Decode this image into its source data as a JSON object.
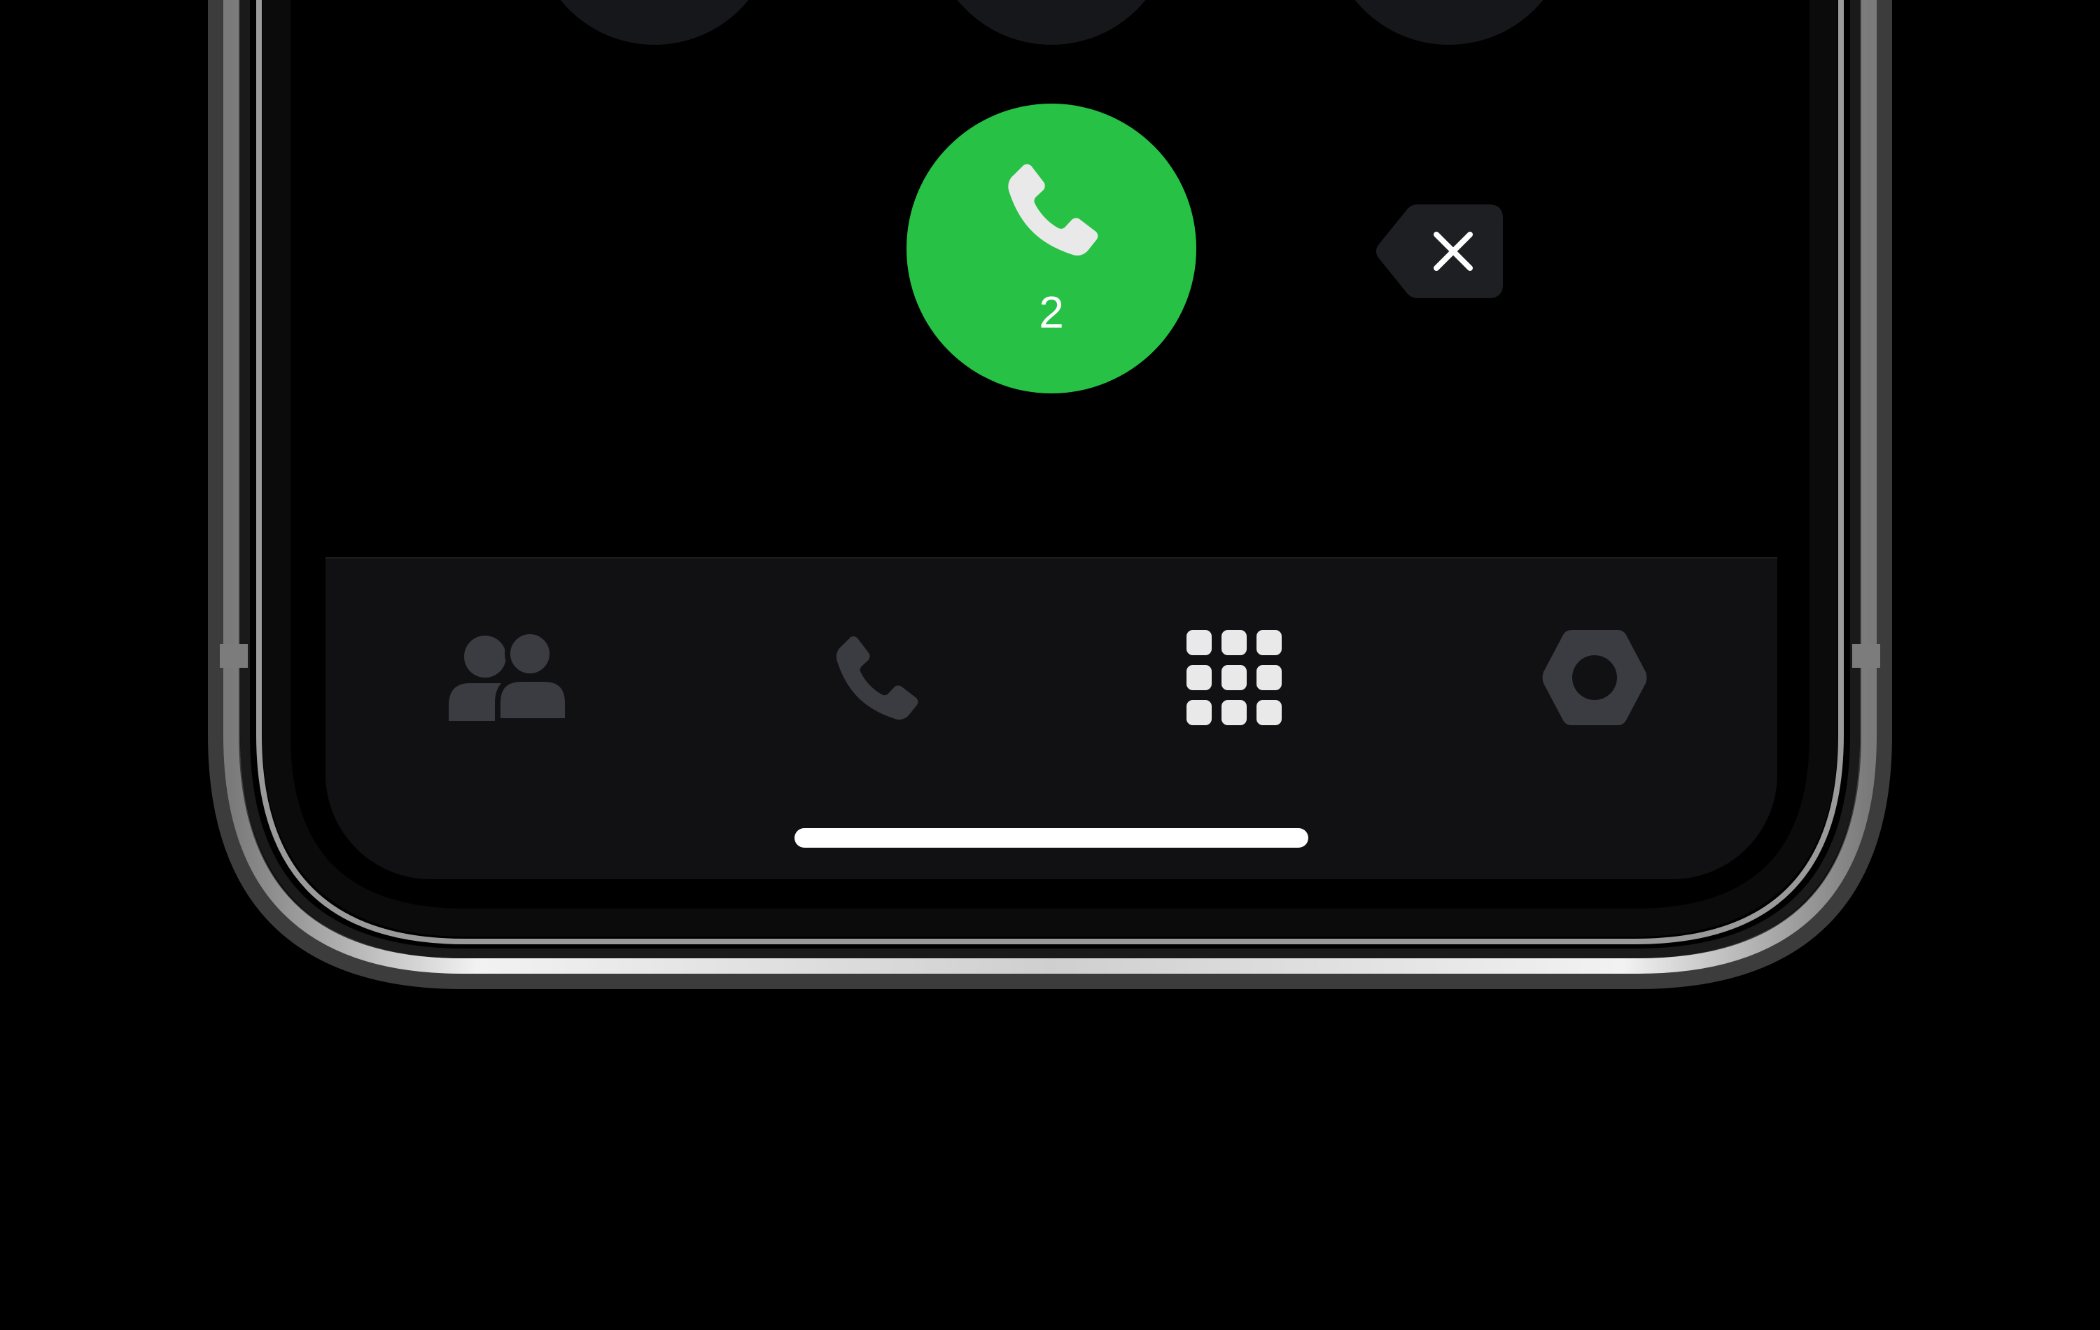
{
  "dialer": {
    "call_button": {
      "label": "2",
      "color": "#27c145",
      "icon": "phone-icon"
    },
    "delete_button": {
      "icon": "backspace-icon",
      "color": "#1e1f23"
    }
  },
  "tab_bar": {
    "tabs": [
      {
        "name": "contacts",
        "icon": "contacts-icon",
        "active": false,
        "color": "#3a3c41"
      },
      {
        "name": "recents",
        "icon": "phone-icon",
        "active": false,
        "color": "#3a3c41"
      },
      {
        "name": "keypad",
        "icon": "keypad-grid-icon",
        "active": true,
        "color": "#e9e9ea"
      },
      {
        "name": "settings",
        "icon": "gear-hexagon-icon",
        "active": false,
        "color": "#3a3c41"
      }
    ]
  },
  "colors": {
    "background": "#000000",
    "screen": "#000000",
    "tab_bar": "#111113",
    "dial_key": "#16171a",
    "accent_green": "#27c145",
    "inactive_icon": "#3a3c41",
    "active_icon": "#e9e9ea"
  }
}
